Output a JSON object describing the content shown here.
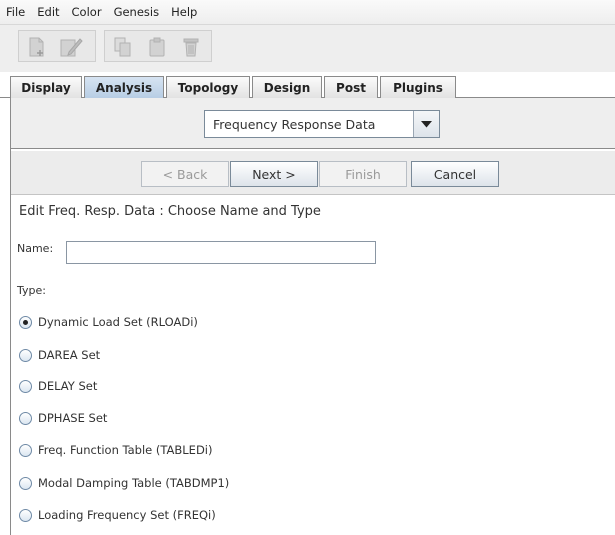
{
  "menu": {
    "items": [
      "File",
      "Edit",
      "Color",
      "Genesis",
      "Help"
    ]
  },
  "toolbar": {
    "icons": [
      "new-icon",
      "edit-icon",
      "copy-icon",
      "paste-icon",
      "delete-icon"
    ]
  },
  "tabs": [
    {
      "label": "Display",
      "active": false
    },
    {
      "label": "Analysis",
      "active": true
    },
    {
      "label": "Topology",
      "active": false
    },
    {
      "label": "Design",
      "active": false
    },
    {
      "label": "Post",
      "active": false
    },
    {
      "label": "Plugins",
      "active": false
    }
  ],
  "combo": {
    "value": "Frequency Response Data"
  },
  "wizard": {
    "back_label": "< Back",
    "next_label": "Next >",
    "finish_label": "Finish",
    "cancel_label": "Cancel"
  },
  "form": {
    "heading": "Edit Freq. Resp. Data : Choose Name and Type",
    "name_label": "Name:",
    "name_value": "",
    "type_label": "Type:",
    "options": [
      {
        "label": "Dynamic Load Set (RLOADi)",
        "selected": true
      },
      {
        "label": "DAREA Set",
        "selected": false
      },
      {
        "label": "DELAY Set",
        "selected": false
      },
      {
        "label": "DPHASE Set",
        "selected": false
      },
      {
        "label": "Freq. Function Table (TABLEDi)",
        "selected": false
      },
      {
        "label": "Modal Damping Table (TABDMP1)",
        "selected": false
      },
      {
        "label": "Loading Frequency Set (FREQi)",
        "selected": false
      }
    ]
  },
  "colors": {
    "active_tab": "#c6d8ec",
    "panel": "#eeeeee",
    "border": "#8a8a8a"
  }
}
